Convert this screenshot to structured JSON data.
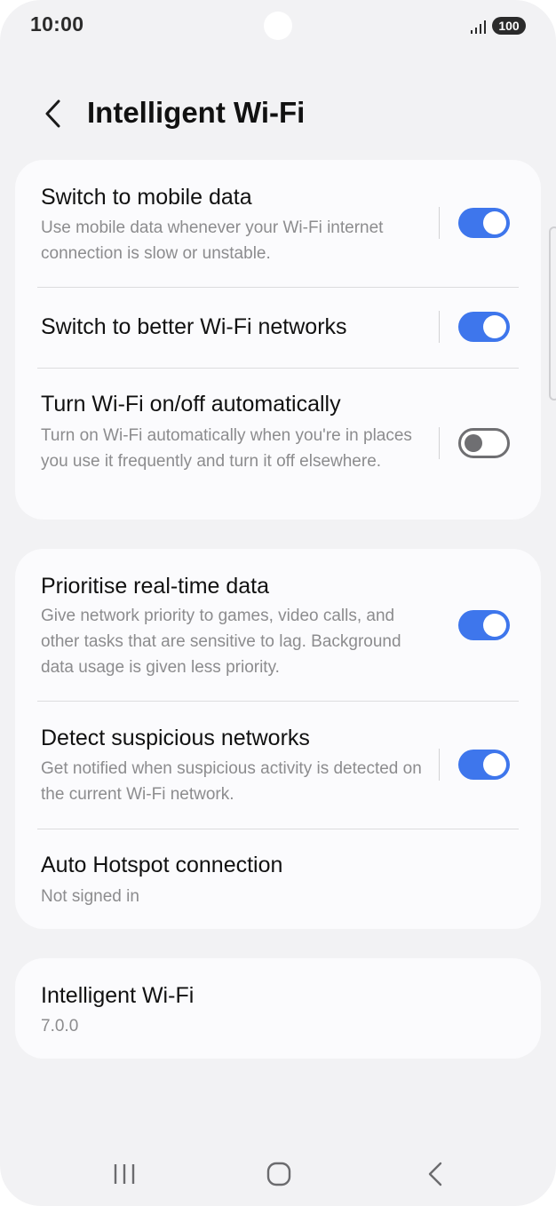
{
  "status_bar": {
    "time": "10:00",
    "battery": "100",
    "signal_icon": "signal-bars-icon"
  },
  "header": {
    "title": "Intelligent Wi-Fi",
    "back_icon": "chevron-left-icon"
  },
  "settings_group_1": {
    "items": [
      {
        "title": "Switch to mobile data",
        "subtitle": "Use mobile data whenever your Wi-Fi internet connection is slow or unstable.",
        "toggle": "on"
      },
      {
        "title": "Switch to better Wi-Fi networks",
        "subtitle": "",
        "toggle": "on"
      },
      {
        "title": "Turn Wi-Fi on/off automatically",
        "subtitle": "Turn on Wi-Fi automatically when you're in places you use it frequently and turn it off elsewhere.",
        "toggle": "off"
      }
    ]
  },
  "settings_group_2": {
    "items": [
      {
        "title": "Prioritise real-time data",
        "subtitle": "Give network priority to games, video calls, and other tasks that are sensitive to lag. Background data usage is given less priority.",
        "toggle": "on"
      },
      {
        "title": "Detect suspicious networks",
        "subtitle": "Get notified when suspicious activity is detected on the current Wi-Fi network.",
        "toggle": "on"
      },
      {
        "title": "Auto Hotspot connection",
        "subtitle": "Not signed in"
      }
    ]
  },
  "about": {
    "title": "Intelligent Wi-Fi",
    "version": "7.0.0"
  },
  "nav_bar": {
    "recents_icon": "recents-icon",
    "home_icon": "home-icon",
    "back_icon": "back-icon"
  },
  "colors": {
    "background": "#f2f2f4",
    "card": "#fbfbfd",
    "toggle_on": "#3e76ec",
    "toggle_off": "#6f6f72"
  }
}
